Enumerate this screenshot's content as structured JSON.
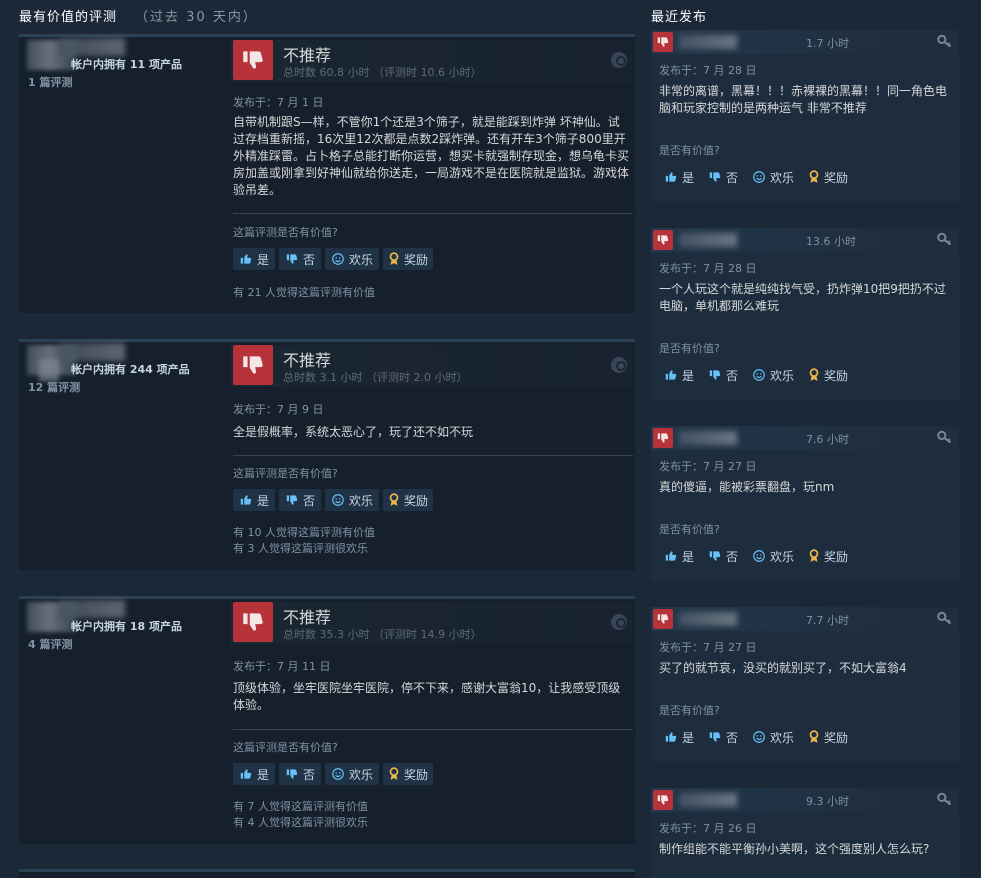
{
  "left_header": {
    "title": "最有价值的评测",
    "subtitle": "（过去 30 天内）"
  },
  "right_header": {
    "title": "最近发布"
  },
  "common": {
    "verdict": "不推荐",
    "helpful_question": "这篇评测是否有价值?",
    "helpful_question_right": "是否有价值?",
    "yes": "是",
    "no": "否",
    "funny": "欢乐",
    "award": "奖励",
    "colors": {
      "thumbs_down_bg": "#b8323a",
      "bg": "#1b2838"
    },
    "icons": [
      "thumbs-down-icon",
      "thumbs-up-icon",
      "smiley-icon",
      "award-icon",
      "steam-icon",
      "key-icon"
    ]
  },
  "top_reviews": [
    {
      "owned": "帐户内拥有 11 项产品",
      "review_count": "1 篇评测",
      "hours": "总时数 60.8 小时 （评测时 10.6 小时）",
      "posted": "发布于：7 月 1 日",
      "content": "自带机制跟S—样，不管你1个还是3个筛子，就是能踩到炸弹 坏神仙。试过存档重新摇，16次里12次都是点数2踩炸弹。还有开车3个筛子800里开外精准踩雷。占卜格子总能打断你运营，想买卡就强制存现金，想乌龟卡买房加盖或刚拿到好神仙就给你送走，一局游戏不是在医院就是监狱。游戏体验吊差。",
      "stat1": "有 21 人觉得这篇评测有价值",
      "stat2": ""
    },
    {
      "owned": "帐户内拥有 244 项产品",
      "review_count": "12 篇评测",
      "hours": "总时数 3.1 小时 （评测时 2.0 小时）",
      "posted": "发布于：7 月 9 日",
      "content": "全是假概率，系统太恶心了，玩了还不如不玩",
      "stat1": "有 10 人觉得这篇评测有价值",
      "stat2": "有 3 人觉得这篇评测很欢乐"
    },
    {
      "owned": "帐户内拥有 18 项产品",
      "review_count": "4 篇评测",
      "hours": "总时数 35.3 小时 （评测时 14.9 小时）",
      "posted": "发布于：7 月 11 日",
      "content": "顶级体验，坐牢医院坐牢医院，停不下来，感谢大富翁10，让我感受顶级体验。",
      "stat1": "有 7 人觉得这篇评测有价值",
      "stat2": "有 4 人觉得这篇评测很欢乐"
    }
  ],
  "recent_reviews": [
    {
      "hours": "1.7 小时",
      "posted": "发布于：7 月 28 日",
      "content": "非常的离谱，黑幕！！！赤裸裸的黑幕！！同一角色电脑和玩家控制的是两种运气 非常不推荐"
    },
    {
      "hours": "13.6 小时",
      "posted": "发布于：7 月 28 日",
      "content": "一个人玩这个就是纯纯找气受，扔炸弹10把9把扔不过电脑，单机都那么难玩"
    },
    {
      "hours": "7.6 小时",
      "posted": "发布于：7 月 27 日",
      "content": "真的傻逼，能被彩票翻盘，玩nm"
    },
    {
      "hours": "7.7 小时",
      "posted": "发布于：7 月 27 日",
      "content": "买了的就节哀，没买的就别买了，不如大富翁4"
    },
    {
      "hours": "9.3 小时",
      "posted": "发布于：7 月 26 日",
      "content": "制作组能不能平衡孙小美啊，这个强度别人怎么玩?"
    }
  ]
}
